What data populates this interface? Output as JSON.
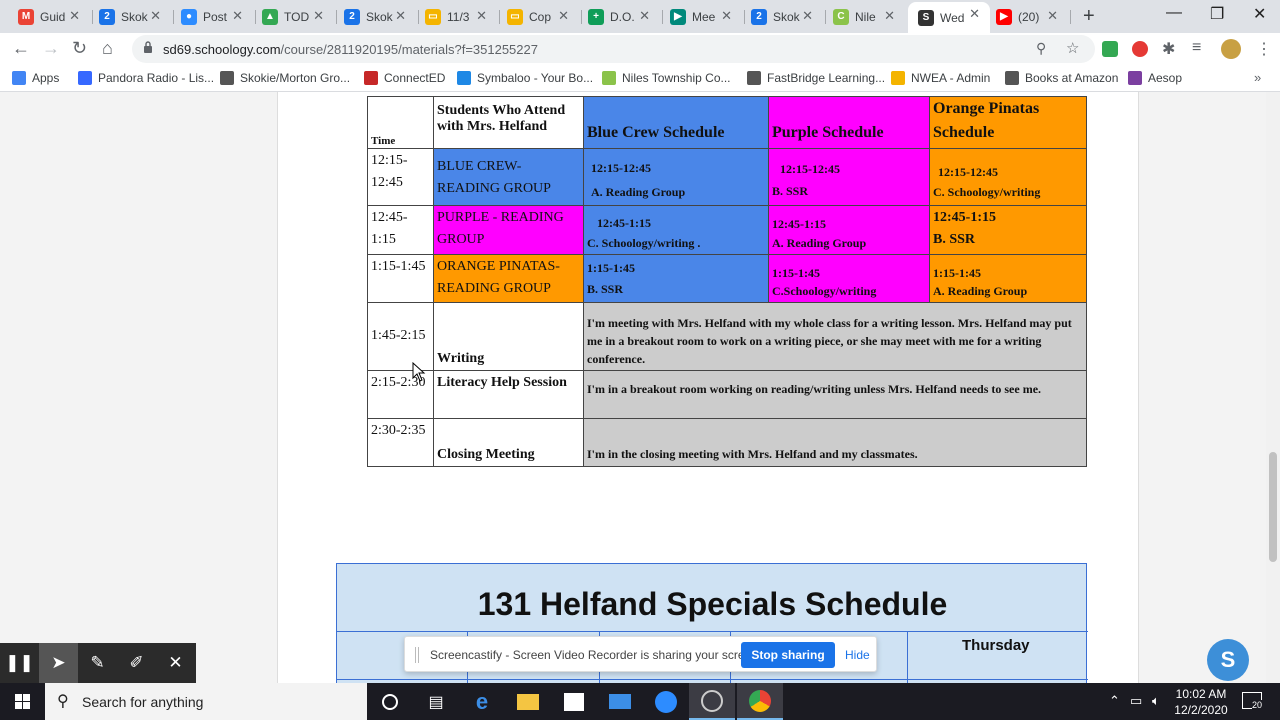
{
  "browser": {
    "tabs": [
      {
        "label": "Guid",
        "fav_color": "#ea4335",
        "fav_glyph": "M"
      },
      {
        "label": "Skok",
        "fav_color": "#1a73e8",
        "fav_glyph": "2"
      },
      {
        "label": "Post",
        "fav_color": "#2d8cff",
        "fav_glyph": "●"
      },
      {
        "label": "TOD",
        "fav_color": "#34a853",
        "fav_glyph": "▲"
      },
      {
        "label": "Skok",
        "fav_color": "#1a73e8",
        "fav_glyph": "2"
      },
      {
        "label": "11/3",
        "fav_color": "#f4b400",
        "fav_glyph": "▭"
      },
      {
        "label": "Cop",
        "fav_color": "#f4b400",
        "fav_glyph": "▭"
      },
      {
        "label": "D.O.",
        "fav_color": "#0f9d58",
        "fav_glyph": "+"
      },
      {
        "label": "Mee",
        "fav_color": "#00897b",
        "fav_glyph": "▶"
      },
      {
        "label": "Skok",
        "fav_color": "#1a73e8",
        "fav_glyph": "2"
      },
      {
        "label": "Nile",
        "fav_color": "#8bc34a",
        "fav_glyph": "C"
      },
      {
        "label": "Wed",
        "fav_color": "#333333",
        "fav_glyph": "S"
      },
      {
        "label": "(20)",
        "fav_color": "#ff0000",
        "fav_glyph": "▶"
      }
    ],
    "url_host": "sd69.schoology.com",
    "url_path": "/course/2811920195/materials?f=351255227",
    "bookmarks": [
      {
        "label": "Apps",
        "color": "#4285f4"
      },
      {
        "label": "Pandora Radio - Lis...",
        "color": "#3668ff"
      },
      {
        "label": "Skokie/Morton Gro...",
        "color": "#555555"
      },
      {
        "label": "ConnectED",
        "color": "#c62828"
      },
      {
        "label": "Symbaloo - Your Bo...",
        "color": "#1e88e5"
      },
      {
        "label": "Niles Township Co...",
        "color": "#8bc34a"
      },
      {
        "label": "FastBridge Learning...",
        "color": "#555555"
      },
      {
        "label": "NWEA - Admin",
        "color": "#f4b400"
      },
      {
        "label": "Books at Amazon",
        "color": "#555555"
      },
      {
        "label": "Aesop",
        "color": "#7b3fa0"
      }
    ]
  },
  "schedule": {
    "header": {
      "time": "Time",
      "students": "Students Who Attend with Mrs. Helfand",
      "blue": "Blue Crew Schedule",
      "purple": "Purple Schedule",
      "orange": "Orange Pinatas Schedule"
    },
    "rows": [
      {
        "time": "12:15-12:45",
        "group": "BLUE CREW- READING GROUP",
        "blue_time": "12:15-12:45",
        "blue_act": "A. Reading Group",
        "purple_time": "12:15-12:45",
        "purple_act": "B.  SSR",
        "orange_time": "12:15-12:45",
        "orange_act": "C. Schoology/writing"
      },
      {
        "time": "12:45-1:15",
        "group": "PURPLE - READING GROUP",
        "blue_time": "12:45-1:15",
        "blue_act": "C. Schoology/writing .",
        "purple_time": "12:45-1:15",
        "purple_act": "A. Reading Group",
        "orange_time": "12:45-1:15",
        "orange_act": "B. SSR"
      },
      {
        "time": "1:15-1:45",
        "group": "ORANGE PINATAS- READING GROUP",
        "blue_time": "1:15-1:45",
        "blue_act": "B. SSR",
        "purple_time": "1:15-1:45",
        "purple_act": "C.Schoology/writing",
        "orange_time": "1:15-1:45",
        "orange_act": "A. Reading Group"
      },
      {
        "time": "1:45-2:15",
        "group": "Writing",
        "note": "I'm meeting with Mrs. Helfand with my whole class for a writing lesson. Mrs. Helfand may put me in a breakout room to work on a writing piece, or she may meet with me for a writing conference."
      },
      {
        "time": "2:15-2:30",
        "group": "Literacy Help Session",
        "note": "I'm in a breakout room working on reading/writing unless Mrs. Helfand needs to see me."
      },
      {
        "time": "2:30-2:35",
        "group": "Closing Meeting",
        "note": "I'm in the closing meeting with Mrs. Helfand and my classmates."
      }
    ]
  },
  "specials": {
    "title": "131 Helfand Specials Schedule",
    "thursday": "Thursday"
  },
  "screencastify": {
    "message": "Screencastify - Screen Video Recorder is sharing your screen.",
    "stop_label": "Stop sharing",
    "hide_label": "Hide"
  },
  "schoology_button": "S",
  "taskbar": {
    "search_placeholder": "Search for anything",
    "time": "10:02 AM",
    "date": "12/2/2020",
    "notif_count": "20"
  }
}
